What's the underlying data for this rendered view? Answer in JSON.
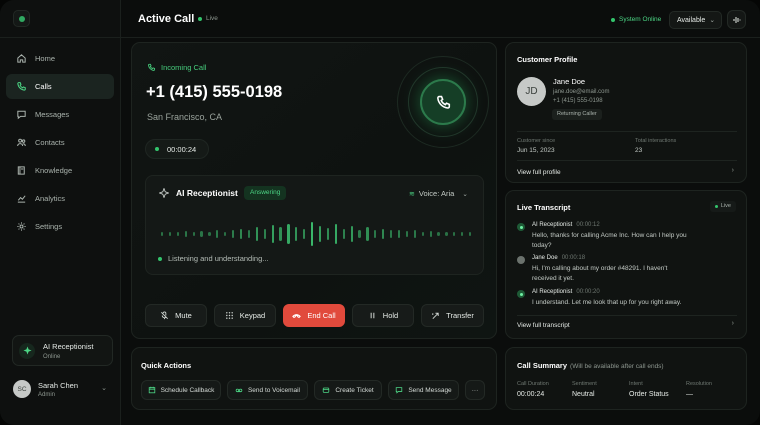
{
  "header": {
    "title": "Active Call",
    "live_label": "Live",
    "system_status": "System Online",
    "availability": "Available"
  },
  "sidebar": {
    "items": [
      {
        "label": "Home",
        "icon": "home-icon"
      },
      {
        "label": "Calls",
        "icon": "phone-icon"
      },
      {
        "label": "Messages",
        "icon": "message-icon"
      },
      {
        "label": "Contacts",
        "icon": "contacts-icon"
      },
      {
        "label": "Knowledge",
        "icon": "book-icon"
      },
      {
        "label": "Analytics",
        "icon": "analytics-icon"
      },
      {
        "label": "Settings",
        "icon": "gear-icon"
      }
    ],
    "active_index": 1,
    "ai_card": {
      "name": "AI Receptionist",
      "status": "Online"
    },
    "user": {
      "initials": "SC",
      "name": "Sarah Chen",
      "role": "Admin"
    }
  },
  "call": {
    "incoming_label": "Incoming Call",
    "phone_number": "+1 (415) 555-0198",
    "location": "San Francisco, CA",
    "duration": "00:00:24",
    "receptionist": {
      "title": "AI Receptionist",
      "status": "Answering",
      "voice": "Voice: Aria",
      "listening": "Listening and understanding..."
    },
    "controls": {
      "mute": "Mute",
      "keypad": "Keypad",
      "end": "End Call",
      "hold": "Hold",
      "transfer": "Transfer"
    }
  },
  "waveform_levels": [
    0.2,
    0.2,
    0.2,
    0.25,
    0.2,
    0.25,
    0.2,
    0.3,
    0.2,
    0.35,
    0.45,
    0.3,
    0.6,
    0.4,
    0.75,
    0.55,
    0.85,
    0.6,
    0.45,
    1.0,
    0.7,
    0.5,
    0.85,
    0.4,
    0.65,
    0.35,
    0.55,
    0.3,
    0.45,
    0.3,
    0.35,
    0.25,
    0.3,
    0.2,
    0.25,
    0.2,
    0.2,
    0.2,
    0.2,
    0.2
  ],
  "profile": {
    "title": "Customer Profile",
    "initials": "JD",
    "name": "Jane Doe",
    "email": "jane.doe@email.com",
    "phone": "+1 (415) 555-0198",
    "tag": "Returning Caller",
    "customer_since_label": "Customer since",
    "customer_since": "Jun 15, 2023",
    "interactions_label": "Total interactions",
    "interactions": "23",
    "link": "View full profile"
  },
  "transcript": {
    "title": "Live Transcript",
    "live_label": "Live",
    "messages": [
      {
        "speaker": "AI Receptionist",
        "time": "00:00:12",
        "role": "ai",
        "text": "Hello, thanks for calling Acme Inc. How can I help you today?"
      },
      {
        "speaker": "Jane Doe",
        "time": "00:00:18",
        "role": "user",
        "text": "Hi, I'm calling about my order #48291. I haven't received it yet."
      },
      {
        "speaker": "AI Receptionist",
        "time": "00:00:20",
        "role": "ai",
        "text": "I understand. Let me look that up for you right away."
      }
    ],
    "link": "View full transcript"
  },
  "quick_actions": {
    "title": "Quick Actions",
    "items": [
      "Schedule Callback",
      "Send to Voicemail",
      "Create Ticket",
      "Send Message"
    ],
    "more": "···"
  },
  "summary": {
    "title": "Call Summary",
    "subtitle": "(Will be available after call ends)",
    "fields": [
      {
        "label": "Call Duration",
        "value": "00:00:24"
      },
      {
        "label": "Sentiment",
        "value": "Neutral"
      },
      {
        "label": "Intent",
        "value": "Order Status"
      },
      {
        "label": "Resolution",
        "value": "—"
      }
    ]
  },
  "colors": {
    "accent": "#33c46c",
    "danger": "#e14a3c",
    "background": "#0b0d0c"
  }
}
